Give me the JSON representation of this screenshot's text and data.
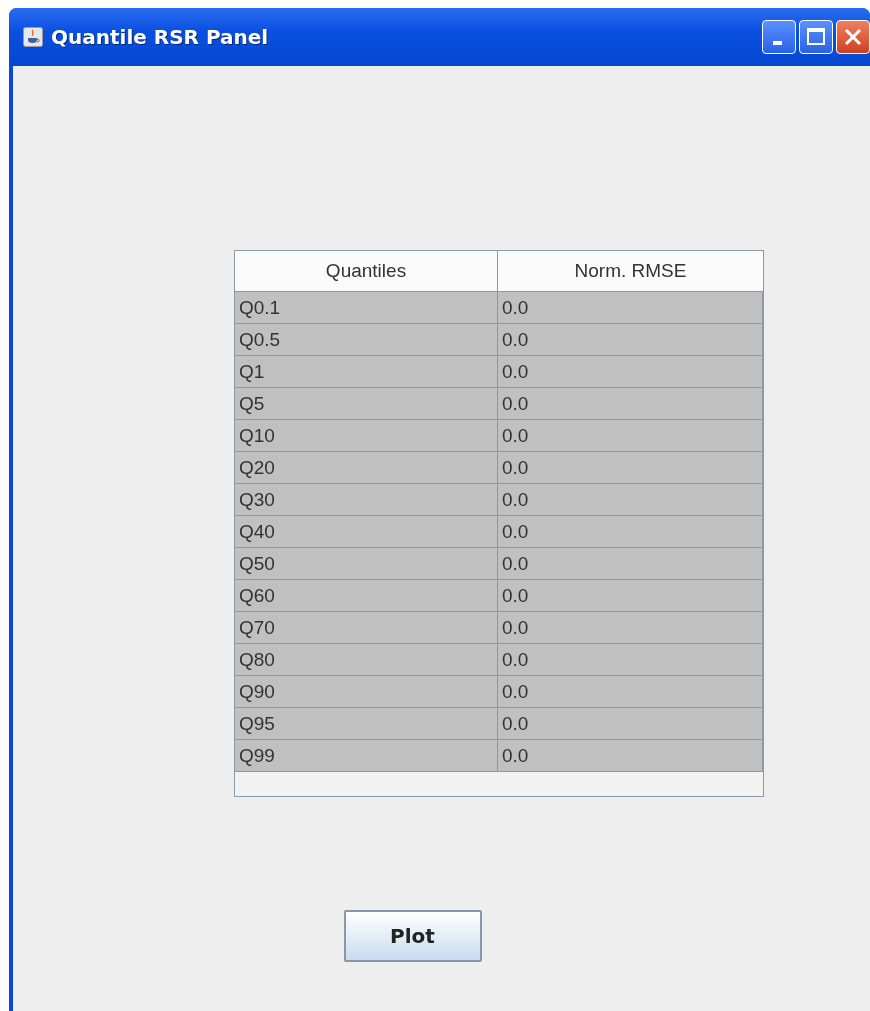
{
  "window": {
    "title": "Quantile RSR Panel"
  },
  "table": {
    "columns": [
      "Quantiles",
      "Norm. RMSE"
    ],
    "rows": [
      {
        "quantile": "Q0.1",
        "rmse": "0.0"
      },
      {
        "quantile": "Q0.5",
        "rmse": "0.0"
      },
      {
        "quantile": "Q1",
        "rmse": "0.0"
      },
      {
        "quantile": "Q5",
        "rmse": "0.0"
      },
      {
        "quantile": "Q10",
        "rmse": "0.0"
      },
      {
        "quantile": "Q20",
        "rmse": "0.0"
      },
      {
        "quantile": "Q30",
        "rmse": "0.0"
      },
      {
        "quantile": "Q40",
        "rmse": "0.0"
      },
      {
        "quantile": "Q50",
        "rmse": "0.0"
      },
      {
        "quantile": "Q60",
        "rmse": "0.0"
      },
      {
        "quantile": "Q70",
        "rmse": "0.0"
      },
      {
        "quantile": "Q80",
        "rmse": "0.0"
      },
      {
        "quantile": "Q90",
        "rmse": "0.0"
      },
      {
        "quantile": "Q95",
        "rmse": "0.0"
      },
      {
        "quantile": "Q99",
        "rmse": "0.0"
      }
    ]
  },
  "buttons": [
    "Plot"
  ]
}
